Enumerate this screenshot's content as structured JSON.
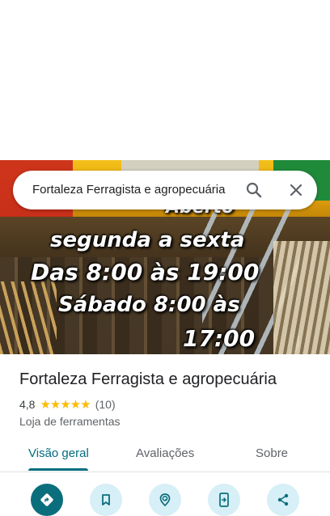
{
  "search": {
    "query": "Fortaleza Ferragista e agropecuária",
    "search_icon": "search-icon",
    "clear_icon": "close-icon"
  },
  "photo": {
    "overlay_lines": [
      "Aberto",
      "segunda a  sexta",
      "Das 8:00 às 19:00",
      "Sábado  8:00 às",
      "17:00"
    ]
  },
  "place": {
    "name": "Fortaleza Ferragista e agropecuária",
    "rating": "4,8",
    "stars": "★★★★★",
    "review_count": "(10)",
    "category": "Loja de ferramentas"
  },
  "tabs": [
    {
      "label": "Visão geral",
      "active": true
    },
    {
      "label": "Avaliações",
      "active": false
    },
    {
      "label": "Sobre",
      "active": false
    }
  ],
  "actions": [
    {
      "icon": "directions-icon"
    },
    {
      "icon": "bookmark-icon"
    },
    {
      "icon": "nearby-icon"
    },
    {
      "icon": "send-to-phone-icon"
    },
    {
      "icon": "share-icon"
    }
  ],
  "colors": {
    "accent": "#006d7e",
    "primary_button": "#0b6e7c",
    "secondary_button": "#d7eff6",
    "star": "#fbbc04"
  }
}
